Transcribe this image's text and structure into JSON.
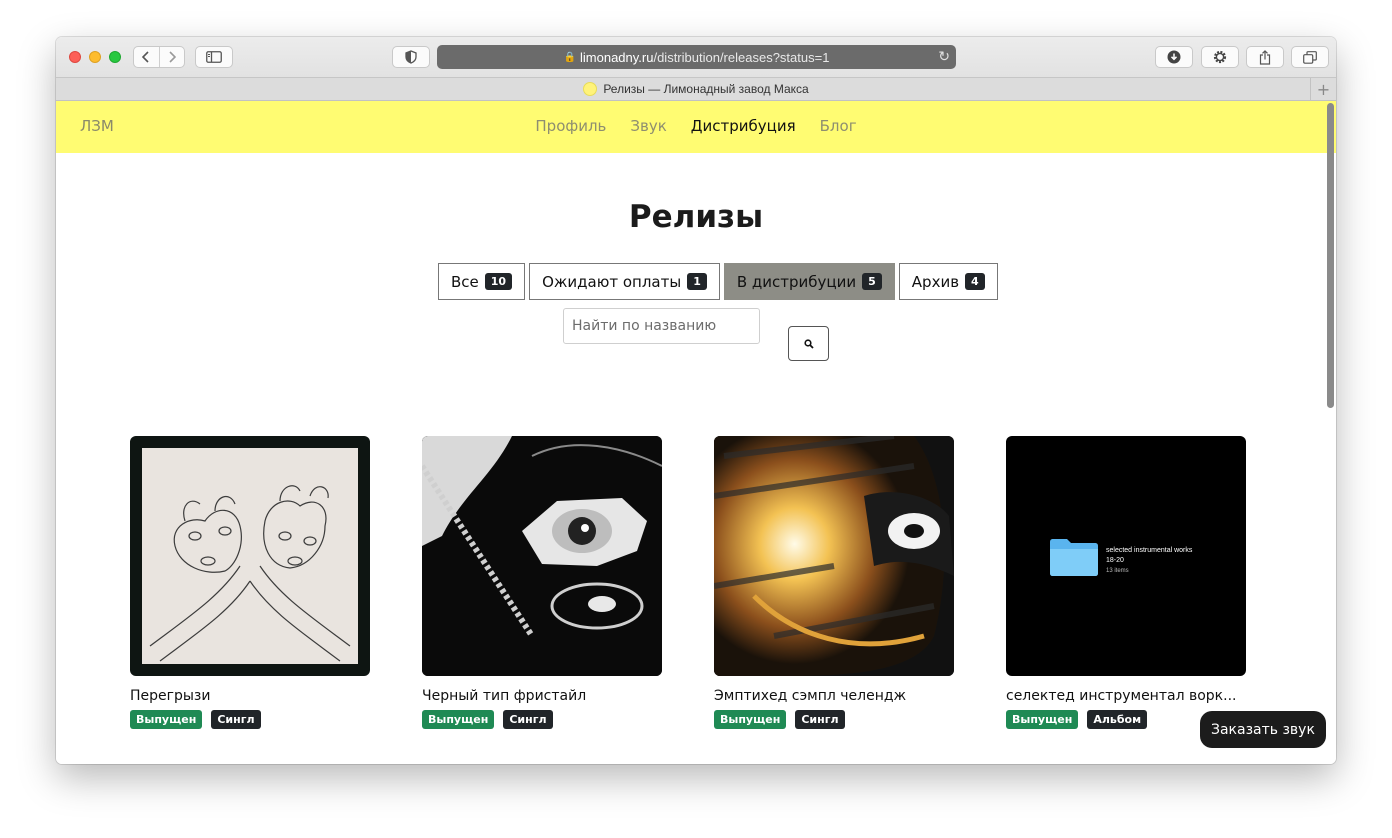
{
  "browser": {
    "url_host": "limonadny.ru",
    "url_path": "/distribution/releases?status=1",
    "tab_title": "Релизы — Лимонадный завод Макса"
  },
  "navbar": {
    "brand": "ЛЗМ",
    "items": [
      {
        "label": "Профиль",
        "active": false
      },
      {
        "label": "Звук",
        "active": false
      },
      {
        "label": "Дистрибуция",
        "active": true
      },
      {
        "label": "Блог",
        "active": false
      }
    ]
  },
  "page_title": "Релизы",
  "filters": [
    {
      "label": "Все",
      "count": "10",
      "active": false
    },
    {
      "label": "Ожидают оплаты",
      "count": "1",
      "active": false
    },
    {
      "label": "В дистрибуции",
      "count": "5",
      "active": true
    },
    {
      "label": "Архив",
      "count": "4",
      "active": false
    }
  ],
  "search": {
    "placeholder": "Найти по названию"
  },
  "releases": [
    {
      "title": "Перегрызи",
      "status": "Выпущен",
      "type": "Сингл"
    },
    {
      "title": "Черный тип фристайл",
      "status": "Выпущен",
      "type": "Сингл"
    },
    {
      "title": "Эмптихед сэмпл челендж",
      "status": "Выпущен",
      "type": "Сингл"
    },
    {
      "title": "селектед инструментал ворк...",
      "status": "Выпущен",
      "type": "Альбом",
      "cover_text": {
        "line1": "selected instrumental works",
        "line2": "18-20",
        "line3": "13 items"
      }
    }
  ],
  "order_button": "Заказать звук",
  "colors": {
    "navbar_bg": "#fffc72",
    "status_badge": "#1f8a54",
    "type_badge": "#212529",
    "active_filter": "#8d8d86"
  }
}
